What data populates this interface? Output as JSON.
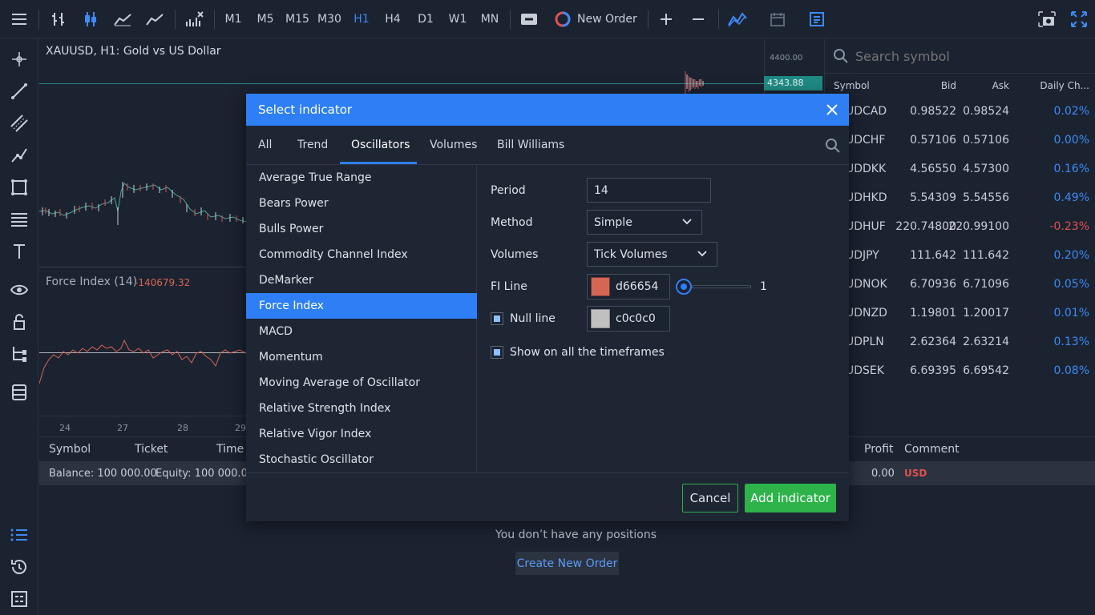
{
  "toolbar": {
    "timeframes": [
      "M1",
      "M5",
      "M15",
      "M30",
      "H1",
      "H4",
      "D1",
      "W1",
      "MN"
    ],
    "active_timeframe": "H1",
    "new_order_label": "New Order",
    "accent": "#3d8bf5"
  },
  "chart": {
    "title": "XAUUSD, H1: Gold vs US Dollar",
    "price_top": "4400.00",
    "price_current": "4343.88",
    "indicator_label": "Force Index (14)",
    "indicator_value": "-140679.32",
    "date_labels": [
      "24",
      "27",
      "28",
      "29"
    ]
  },
  "watch": {
    "search_placeholder": "Search symbol",
    "headers": {
      "symbol": "Symbol",
      "bid": "Bid",
      "ask": "Ask",
      "change": "Daily Ch..."
    },
    "rows": [
      {
        "symbol": "UDCAD",
        "bid": "0.98522",
        "ask": "0.98524",
        "change": "0.02%",
        "neg": false
      },
      {
        "symbol": "UDCHF",
        "bid": "0.57106",
        "ask": "0.57106",
        "change": "0.00%",
        "neg": false
      },
      {
        "symbol": "UDDKK",
        "bid": "4.56550",
        "ask": "4.57300",
        "change": "0.16%",
        "neg": false
      },
      {
        "symbol": "UDHKD",
        "bid": "5.54309",
        "ask": "5.54556",
        "change": "0.49%",
        "neg": false
      },
      {
        "symbol": "UDHUF",
        "bid": "220.74800",
        "ask": "220.99100",
        "change": "-0.23%",
        "neg": true
      },
      {
        "symbol": "UDJPY",
        "bid": "111.642",
        "ask": "111.642",
        "change": "0.20%",
        "neg": false
      },
      {
        "symbol": "UDNOK",
        "bid": "6.70936",
        "ask": "6.71096",
        "change": "0.05%",
        "neg": false
      },
      {
        "symbol": "UDNZD",
        "bid": "1.19801",
        "ask": "1.20017",
        "change": "0.01%",
        "neg": false
      },
      {
        "symbol": "UDPLN",
        "bid": "2.62364",
        "ask": "2.63214",
        "change": "0.13%",
        "neg": false
      },
      {
        "symbol": "UDSEK",
        "bid": "6.69395",
        "ask": "6.69542",
        "change": "0.08%",
        "neg": false
      }
    ]
  },
  "positions": {
    "col_symbol": "Symbol",
    "col_ticket": "Ticket",
    "col_time": "Time",
    "col_profit": "Profit",
    "col_comment": "Comment",
    "balance": "Balance: 100 000.00",
    "equity": "Equity: 100 000.00",
    "profit_value": "0.00",
    "currency": "USD",
    "empty_text": "You don’t have any positions",
    "create_order_label": "Create New Order"
  },
  "dialog": {
    "title": "Select indicator",
    "tabs": [
      "All",
      "Trend",
      "Oscillators",
      "Volumes",
      "Bill Williams"
    ],
    "active_tab": "Oscillators",
    "indicators": [
      "Average True Range",
      "Bears Power",
      "Bulls Power",
      "Commodity Channel Index",
      "DeMarker",
      "Force Index",
      "MACD",
      "Momentum",
      "Moving Average of Oscillator",
      "Relative Strength Index",
      "Relative Vigor Index",
      "Stochastic Oscillator"
    ],
    "selected_indicator": "Force Index",
    "params": {
      "period_label": "Period",
      "period_value": "14",
      "method_label": "Method",
      "method_value": "Simple",
      "volumes_label": "Volumes",
      "volumes_value": "Tick Volumes",
      "fi_line_label": "FI Line",
      "fi_line_color": "d66654",
      "fi_line_width": "1",
      "null_line_label": "Null line",
      "null_line_color": "c0c0c0",
      "show_all_label": "Show on all the timeframes"
    },
    "cancel_label": "Cancel",
    "add_label": "Add indicator"
  },
  "colors": {
    "fi_swatch": "#d66654",
    "null_swatch": "#c0c0c0",
    "positive": "#3d8bf5",
    "negative": "#e0514f",
    "add_button": "#2db34a"
  }
}
